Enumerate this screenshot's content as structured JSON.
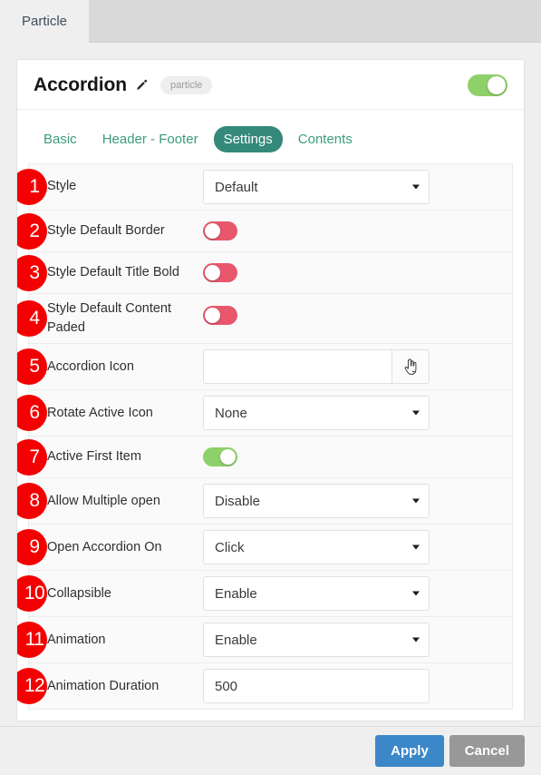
{
  "window": {
    "tabs": [
      {
        "label": "Particle",
        "active": true
      }
    ]
  },
  "card": {
    "title": "Accordion",
    "edit_icon": "pencil-icon",
    "type_badge": "particle",
    "enabled_toggle": {
      "state": "on",
      "color": "#8ed06a"
    }
  },
  "subtabs": [
    {
      "label": "Basic",
      "active": false
    },
    {
      "label": "Header - Footer",
      "active": false
    },
    {
      "label": "Settings",
      "active": true
    },
    {
      "label": "Contents",
      "active": false
    }
  ],
  "settings_rows": [
    {
      "number": "1",
      "label": "Style",
      "control": "select",
      "value": "Default"
    },
    {
      "number": "2",
      "label": "Style Default Border",
      "control": "toggle",
      "value": "off"
    },
    {
      "number": "3",
      "label": "Style Default Title Bold",
      "control": "toggle",
      "value": "off"
    },
    {
      "number": "4",
      "label": "Style Default Content Paded",
      "control": "toggle",
      "value": "off"
    },
    {
      "number": "5",
      "label": "Accordion Icon",
      "control": "iconpicker",
      "value": "",
      "placeholder": "",
      "button_icon": "hand-pointer-icon"
    },
    {
      "number": "6",
      "label": "Rotate Active Icon",
      "control": "select",
      "value": "None"
    },
    {
      "number": "7",
      "label": "Active First Item",
      "control": "toggle",
      "value": "on"
    },
    {
      "number": "8",
      "label": "Allow Multiple open",
      "control": "select",
      "value": "Disable"
    },
    {
      "number": "9",
      "label": "Open Accordion On",
      "control": "select",
      "value": "Click"
    },
    {
      "number": "10",
      "label": "Collapsible",
      "control": "select",
      "value": "Enable"
    },
    {
      "number": "11",
      "label": "Animation",
      "control": "select",
      "value": "Enable"
    },
    {
      "number": "12",
      "label": "Animation Duration",
      "control": "text",
      "value": "500",
      "placeholder": ""
    }
  ],
  "footer": {
    "apply_label": "Apply",
    "cancel_label": "Cancel"
  },
  "colors": {
    "toggle_on": "#8ed06a",
    "toggle_off": "#e8576b",
    "accent_teal": "#35897a",
    "badge_red": "#f50000",
    "apply_blue": "#3b87c8",
    "cancel_gray": "#989898"
  }
}
